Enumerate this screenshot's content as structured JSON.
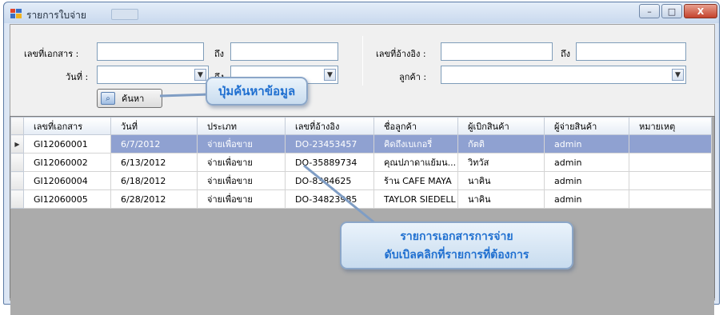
{
  "window": {
    "title": "รายการใบจ่าย"
  },
  "titlebar_buttons": {
    "minimize": "–",
    "maximize": "□",
    "close": "X"
  },
  "search_form": {
    "doc_no_label": "เลขที่เอกสาร :",
    "doc_no_from": "",
    "to_label_1": "ถึง",
    "doc_no_to": "",
    "date_label": "วันที่ :",
    "date_from": "",
    "to_label_2": "ถึง",
    "date_to": "",
    "ref_no_label": "เลขที่อ้างอิง :",
    "ref_no_from": "",
    "to_label_3": "ถึง",
    "ref_no_to": "",
    "customer_label": "ลูกค้า :",
    "customer_value": "",
    "search_button_label": "ค้นหา"
  },
  "callouts": {
    "search_hint": "ปุ่มค้นหาข้อมูล",
    "grid_hint_line1": "รายการเอกสารการจ่าย",
    "grid_hint_line2": "ดับเบิลคลิกที่รายการที่ต้องการ"
  },
  "grid": {
    "columns": [
      "เลขที่เอกสาร",
      "วันที่",
      "ประเภท",
      "เลขที่อ้างอิง",
      "ชื่อลูกค้า",
      "ผู้เบิกสินค้า",
      "ผู้จ่ายสินค้า",
      "หมายเหตุ"
    ],
    "rows": [
      [
        "GI12060001",
        "6/7/2012",
        "จ่ายเพื่อขาย",
        "DO-23453457",
        "คิดถึงเบเกอรี่",
        "กัตติ",
        "admin",
        ""
      ],
      [
        "GI12060002",
        "6/13/2012",
        "จ่ายเพื่อขาย",
        "DO-35889734",
        "คุณปภาดาแย้มน...",
        "วิทวัส",
        "admin",
        ""
      ],
      [
        "GI12060004",
        "6/18/2012",
        "จ่ายเพื่อขาย",
        "DO-8384625",
        "ร้าน CAFE MAYA",
        "นาคิน",
        "admin",
        ""
      ],
      [
        "GI12060005",
        "6/28/2012",
        "จ่ายเพื่อขาย",
        "DO-34823985",
        "TAYLOR SIEDELL",
        "นาคิน",
        "admin",
        ""
      ]
    ],
    "selected_row": 0,
    "row_indicator": "▶"
  },
  "colors": {
    "selection": "#8fa1d1",
    "callout_text": "#1f6fd0",
    "window_border": "#5b7aa5"
  }
}
